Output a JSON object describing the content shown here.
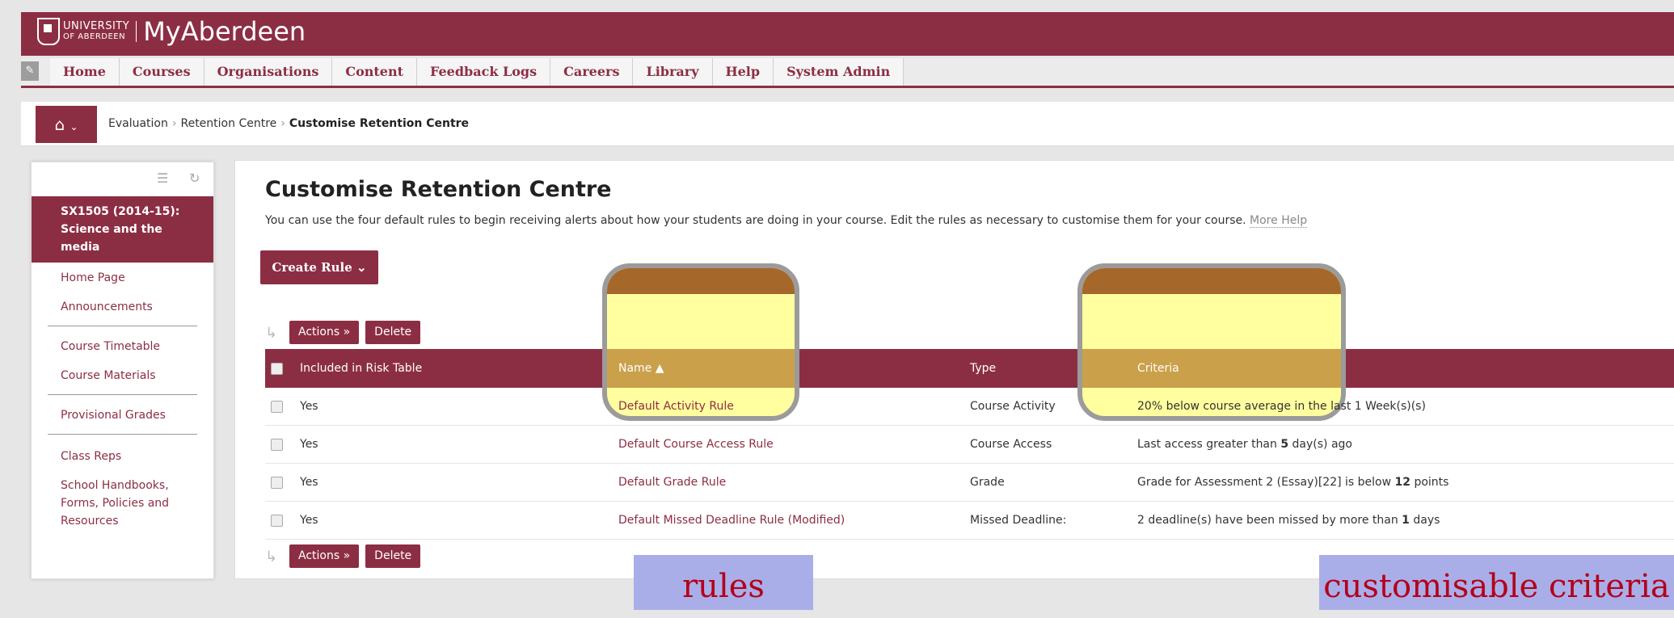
{
  "app": {
    "university_line1": "UNIVERSITY",
    "university_line2": "OF ABERDEEN",
    "title": "MyAberdeen"
  },
  "nav": {
    "tabs": [
      "Home",
      "Courses",
      "Organisations",
      "Content",
      "Feedback Logs",
      "Careers",
      "Library",
      "Help",
      "System Admin"
    ]
  },
  "breadcrumb": {
    "items": [
      "Evaluation",
      "Retention Centre"
    ],
    "current": "Customise Retention Centre"
  },
  "sidebar": {
    "course": "SX1505 (2014-15): Science and the media",
    "items": [
      "Home Page",
      "Announcements",
      "Course Timetable",
      "Course Materials",
      "Provisional Grades",
      "Class Reps",
      "School Handbooks, Forms, Policies and Resources"
    ]
  },
  "main": {
    "title": "Customise Retention Centre",
    "description": "You can use the four default rules to begin receiving alerts about how your students are doing in your course. Edit the rules as necessary to customise them for your course.",
    "more_help": "More Help",
    "create_rule": "Create Rule",
    "actions": "Actions",
    "delete": "Delete"
  },
  "table": {
    "headers": {
      "included": "Included in Risk Table",
      "name": "Name",
      "type": "Type",
      "criteria": "Criteria"
    },
    "rows": [
      {
        "included": "Yes",
        "name": "Default Activity Rule",
        "type": "Course Activity",
        "criteria": "20% below course average in the last 1 Week(s)(s)"
      },
      {
        "included": "Yes",
        "name": "Default Course Access Rule",
        "type": "Course Access",
        "criteria_pre": "Last access greater than ",
        "criteria_bold": "5",
        "criteria_post": " day(s) ago"
      },
      {
        "included": "Yes",
        "name": "Default Grade Rule",
        "type": "Grade",
        "criteria_pre": "Grade for Assessment 2 (Essay)[22] is below ",
        "criteria_bold": "12",
        "criteria_post": " points"
      },
      {
        "included": "Yes",
        "name": "Default Missed Deadline Rule (Modified)",
        "type": "Missed Deadline:",
        "criteria_pre": "2 deadline(s) have been missed by more than ",
        "criteria_bold": "1",
        "criteria_post": " days"
      }
    ]
  },
  "annotations": {
    "rules": "rules",
    "criteria": "customisable criteria"
  },
  "colors": {
    "brand": "#8c2e43",
    "highlight": "#ffff50",
    "label_bg": "#aaaee8",
    "label_text": "#b3001b"
  }
}
